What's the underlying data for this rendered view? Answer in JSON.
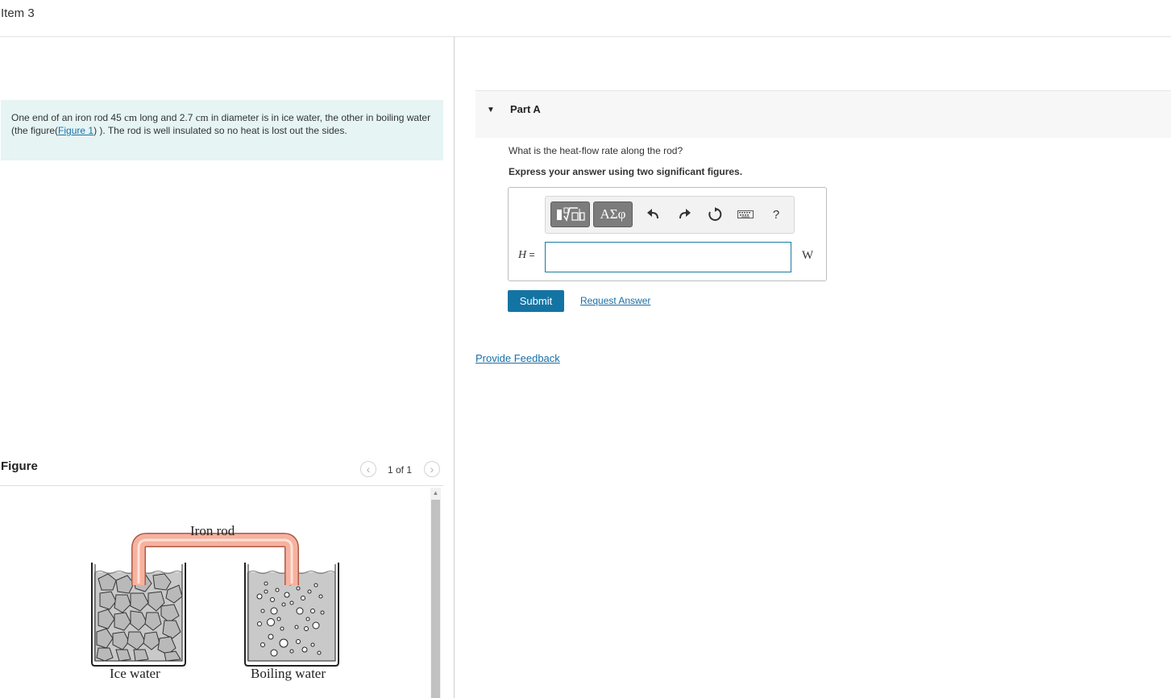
{
  "item": {
    "title": "Item 3"
  },
  "problem": {
    "text_1": "One end of an iron rod 45 ",
    "unit_cm_1": "cm",
    "text_2": " long and 2.7 ",
    "unit_cm_2": "cm",
    "text_3": " in diameter is in ice water, the other in boiling water (the figure(",
    "figure_link": "Figure 1",
    "text_4": ") ). The rod is well insulated so no heat is lost out the sides."
  },
  "figure": {
    "title": "Figure",
    "counter": "1 of 1",
    "labels": {
      "rod": "Iron rod",
      "ice": "Ice water",
      "boiling": "Boiling water"
    }
  },
  "part_a": {
    "title": "Part A",
    "question": "What is the heat-flow rate along the rod?",
    "instruction": "Express your answer using two significant figures.",
    "toolbar": {
      "symbols_label": "ΑΣφ",
      "help_label": "?"
    },
    "variable": "H",
    "equals": " =",
    "input_value": "",
    "unit": "W",
    "submit_label": "Submit",
    "request_answer_label": "Request Answer"
  },
  "feedback": {
    "label": "Provide Feedback"
  }
}
